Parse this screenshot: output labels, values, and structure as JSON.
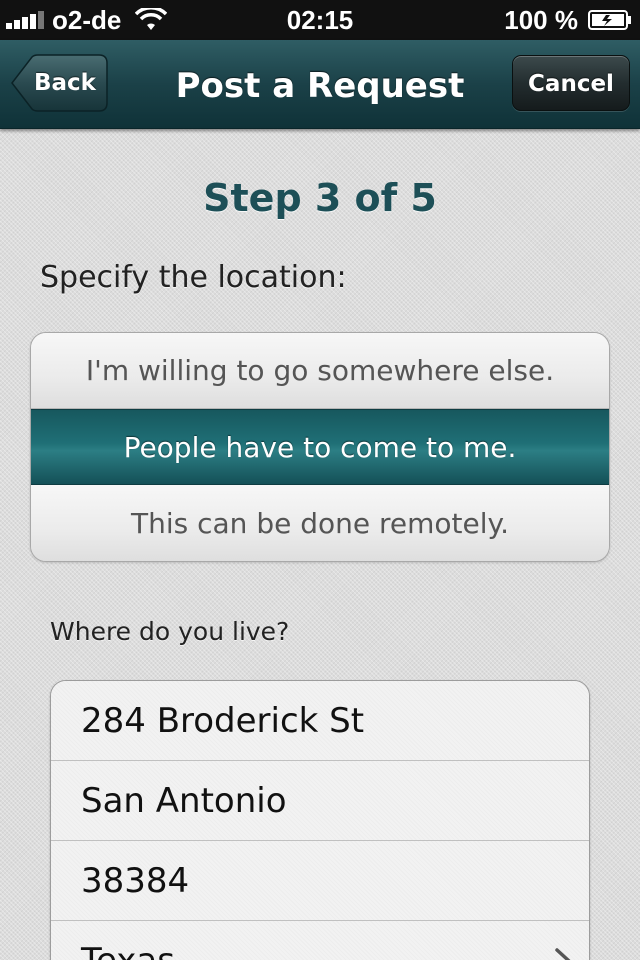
{
  "status_bar": {
    "carrier": "o2-de",
    "time": "02:15",
    "battery": "100 %",
    "icons": [
      "signal-icon",
      "wifi-icon",
      "battery-icon"
    ]
  },
  "nav": {
    "back_label": "Back",
    "title": "Post a Request",
    "cancel_label": "Cancel"
  },
  "step": {
    "title": "Step 3 of 5"
  },
  "location": {
    "label": "Specify the location:",
    "options": [
      {
        "label": "I'm willing to go somewhere else.",
        "selected": false
      },
      {
        "label": "People have to come to me.",
        "selected": true
      },
      {
        "label": "This can be done remotely.",
        "selected": false
      }
    ]
  },
  "address": {
    "label": "Where do you live?",
    "street": "284 Broderick St",
    "city": "San Antonio",
    "zip": "38384",
    "state": "Texas"
  },
  "colors": {
    "accent": "#1d4f57",
    "nav_bar": "#1b4148",
    "selected_segment": "#1f6f76"
  }
}
